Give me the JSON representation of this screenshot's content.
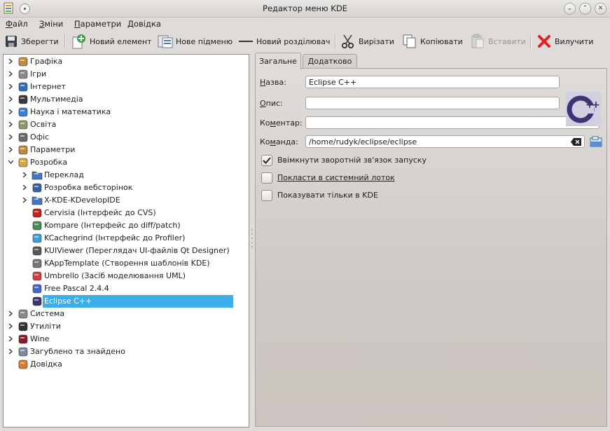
{
  "window": {
    "title": "Редактор меню KDE",
    "buttons": {
      "minimize": "⌄",
      "maximize": "⌃",
      "close": "✕"
    }
  },
  "menubar": [
    {
      "label": "Файл",
      "u": "Ф",
      "rest": "айл"
    },
    {
      "label": "Зміни",
      "u": "З",
      "rest": "міни"
    },
    {
      "label": "Параметри",
      "u": "П",
      "rest": "араметри"
    },
    {
      "label": "Довідка",
      "u": "Д",
      "rest": "овідка"
    }
  ],
  "toolbar": {
    "save": "Зберегти",
    "new_item": "Новий елемент",
    "new_submenu": "Нове підменю",
    "new_separator": "Новий розділювач",
    "cut": "Вирізати",
    "copy": "Копіювати",
    "paste": "Вставити",
    "delete": "Вилучити"
  },
  "tree": [
    {
      "label": "Графіка",
      "level": 0,
      "expander": "collapsed",
      "icon": "graphics-icon"
    },
    {
      "label": "Ігри",
      "level": 0,
      "expander": "collapsed",
      "icon": "games-icon"
    },
    {
      "label": "Інтернет",
      "level": 0,
      "expander": "collapsed",
      "icon": "globe-icon"
    },
    {
      "label": "Мультимедіа",
      "level": 0,
      "expander": "collapsed",
      "icon": "multimedia-icon"
    },
    {
      "label": "Наука і математика",
      "level": 0,
      "expander": "collapsed",
      "icon": "science-flask-icon"
    },
    {
      "label": "Освіта",
      "level": 0,
      "expander": "collapsed",
      "icon": "education-icon"
    },
    {
      "label": "Офіс",
      "level": 0,
      "expander": "collapsed",
      "icon": "office-icon"
    },
    {
      "label": "Параметри",
      "level": 0,
      "expander": "collapsed",
      "icon": "settings-tools-icon"
    },
    {
      "label": "Розробка",
      "level": 0,
      "expander": "expanded",
      "icon": "development-icon"
    },
    {
      "label": "Переклад",
      "level": 1,
      "expander": "collapsed",
      "icon": "folder-icon"
    },
    {
      "label": "Розробка вебсторінок",
      "level": 1,
      "expander": "collapsed",
      "icon": "web-dev-globe-icon"
    },
    {
      "label": "X-KDE-KDevelopIDE",
      "level": 1,
      "expander": "collapsed",
      "icon": "folder-icon"
    },
    {
      "label": "Cervisia (Інтерфейс до CVS)",
      "level": 1,
      "expander": "none",
      "icon": "cervisia-icon"
    },
    {
      "label": "Kompare (Інтерфейс до diff/patch)",
      "level": 1,
      "expander": "none",
      "icon": "kompare-icon"
    },
    {
      "label": "KCachegrind (Інтерфейс до Profiler)",
      "level": 1,
      "expander": "none",
      "icon": "kcachegrind-icon"
    },
    {
      "label": "KUIViewer (Переглядач UI-файлів Qt Designer)",
      "level": 1,
      "expander": "none",
      "icon": "kuiviewer-icon"
    },
    {
      "label": "KAppTemplate (Створення шаблонів KDE)",
      "level": 1,
      "expander": "none",
      "icon": "kapptemplate-icon"
    },
    {
      "label": "Umbrello (Засіб моделювання UML)",
      "level": 1,
      "expander": "none",
      "icon": "umbrello-icon"
    },
    {
      "label": "Free Pascal 2.4.4",
      "level": 1,
      "expander": "none",
      "icon": "free-pascal-icon"
    },
    {
      "label": "Eclipse C++",
      "level": 1,
      "expander": "none",
      "icon": "eclipse-cpp-icon",
      "selected": true
    },
    {
      "label": "Система",
      "level": 0,
      "expander": "collapsed",
      "icon": "system-gear-icon"
    },
    {
      "label": "Утиліти",
      "level": 0,
      "expander": "collapsed",
      "icon": "utilities-icon"
    },
    {
      "label": "Wine",
      "level": 0,
      "expander": "collapsed",
      "icon": "wine-glass-icon"
    },
    {
      "label": "Загублено та знайдено",
      "level": 0,
      "expander": "collapsed",
      "icon": "lost-found-icon"
    },
    {
      "label": "Довідка",
      "level": 0,
      "expander": "none",
      "icon": "help-lifebuoy-icon"
    }
  ],
  "tabs": [
    "Загальне",
    "Додатково"
  ],
  "form": {
    "name_label": {
      "u": "Н",
      "rest": "азва:"
    },
    "name_value": "Eclipse C++",
    "description_label": {
      "u": "О",
      "rest": "пис:"
    },
    "description_value": "",
    "comment_label": {
      "pre": "Ко",
      "u": "м",
      "rest": "ентар:"
    },
    "comment_value": "",
    "command_label": {
      "pre": "Ко",
      "u": "м",
      "rest": "анда:"
    },
    "command_value": "/home/rudyk/eclipse/eclipse",
    "checkboxes": [
      {
        "label": "Ввімкнути зворотній зв'язок запуску",
        "checked": true
      },
      {
        "label": "Покласти в системний лоток",
        "checked": false
      },
      {
        "label": "Показувати тільки в KDE",
        "checked": false
      }
    ]
  },
  "colors": {
    "selection": "#3daee9",
    "window_bg": "#dedbd8"
  }
}
